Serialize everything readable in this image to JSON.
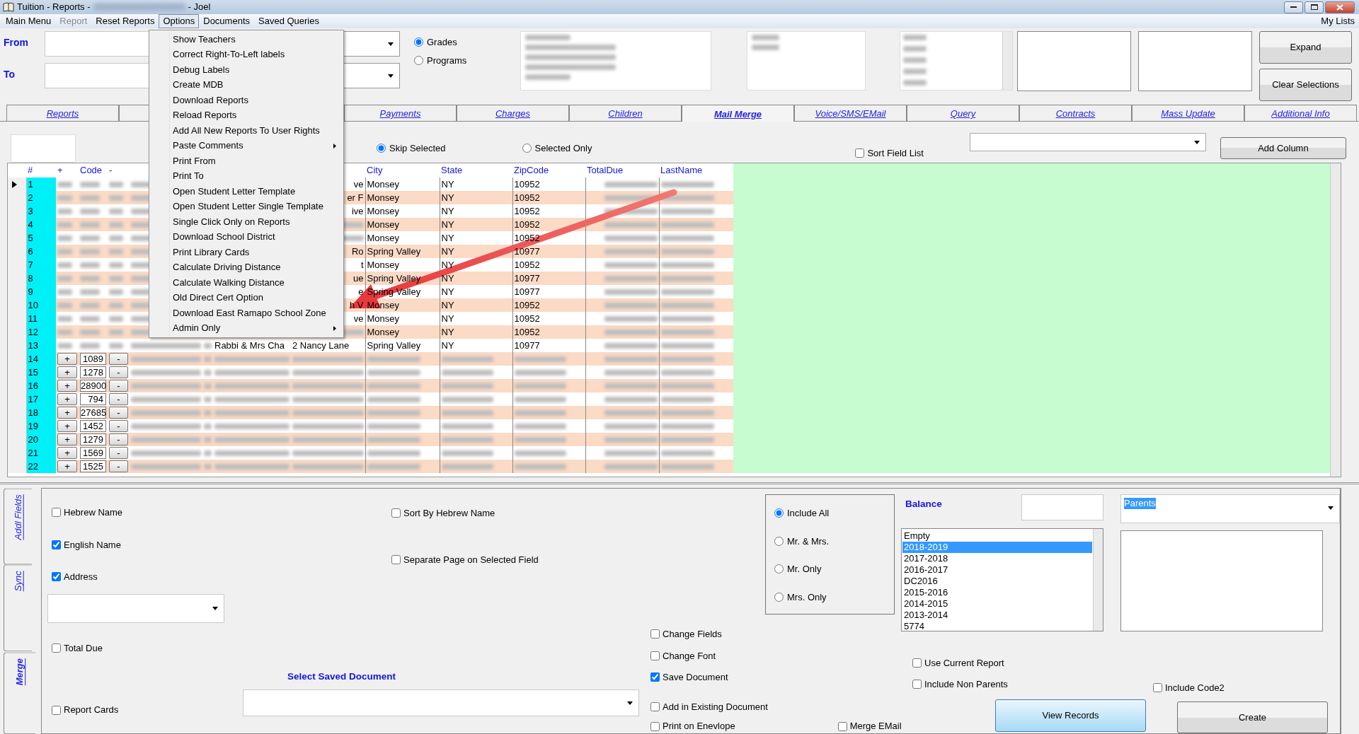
{
  "window": {
    "title": "Tuition - Reports -",
    "title_suffix": "- Joel"
  },
  "menu_bar": {
    "items": [
      {
        "label": "Main Menu",
        "disabled": false,
        "selected": false
      },
      {
        "label": "Report",
        "disabled": true,
        "selected": false
      },
      {
        "label": "Reset Reports",
        "disabled": false,
        "selected": false
      },
      {
        "label": "Options",
        "disabled": false,
        "selected": true
      },
      {
        "label": "Documents",
        "disabled": false,
        "selected": false
      },
      {
        "label": "Saved Queries",
        "disabled": false,
        "selected": false
      }
    ],
    "right_label": "My Lists"
  },
  "options_menu": [
    {
      "label": "Show Teachers",
      "submenu": false
    },
    {
      "label": "Correct Right-To-Left labels",
      "submenu": false
    },
    {
      "label": "Debug Labels",
      "submenu": false
    },
    {
      "label": "Create MDB",
      "submenu": false
    },
    {
      "label": "Download Reports",
      "submenu": false
    },
    {
      "label": "Reload Reports",
      "submenu": false
    },
    {
      "label": "Add All New Reports To User Rights",
      "submenu": false
    },
    {
      "label": "Paste Comments",
      "submenu": true
    },
    {
      "label": "Print From",
      "submenu": false
    },
    {
      "label": "Print To",
      "submenu": false
    },
    {
      "label": "Open Student Letter Template",
      "submenu": false
    },
    {
      "label": "Open Student Letter Single Template",
      "submenu": false
    },
    {
      "label": "Single Click Only on Reports",
      "submenu": false
    },
    {
      "label": "Download School District",
      "submenu": false
    },
    {
      "label": "Print Library Cards",
      "submenu": false
    },
    {
      "label": "Calculate Driving Distance",
      "submenu": false
    },
    {
      "label": "Calculate Walking Distance",
      "submenu": false
    },
    {
      "label": "Old Direct Cert Option",
      "submenu": false
    },
    {
      "label": "Download East Ramapo School Zone",
      "submenu": false
    },
    {
      "label": "Admin Only",
      "submenu": true
    }
  ],
  "filters": {
    "from_label": "From",
    "to_label": "To",
    "radios": [
      {
        "label": "Grades",
        "selected": true
      },
      {
        "label": "Programs",
        "selected": false
      }
    ],
    "buttons": [
      "Expand",
      "Clear Selections"
    ]
  },
  "tabs": [
    {
      "label": "Reports",
      "selected": false
    },
    {
      "label": "Payments",
      "selected": false
    },
    {
      "label": "Charges",
      "selected": false
    },
    {
      "label": "Children",
      "selected": false
    },
    {
      "label": "Mail Merge",
      "selected": true
    },
    {
      "label": "Voice/SMS/EMail",
      "selected": false
    },
    {
      "label": "Query",
      "selected": false
    },
    {
      "label": "Contracts",
      "selected": false
    },
    {
      "label": "Mass Update",
      "selected": false
    },
    {
      "label": "Additional Info",
      "selected": false
    }
  ],
  "toolbar": {
    "radios": [
      {
        "label": "Skip Selected",
        "selected": true
      },
      {
        "label": "Selected Only",
        "selected": false
      }
    ],
    "sort_field_list": {
      "label": "Sort Field List",
      "checked": false
    },
    "add_column": "Add Column"
  },
  "grid": {
    "columns": [
      "#",
      "+",
      "Code",
      "-",
      "City",
      "State",
      "ZipCode",
      "TotalDue",
      "LastName"
    ],
    "rows": [
      {
        "num": "1",
        "current": true,
        "address": "ve",
        "city": "Monsey",
        "state": "NY",
        "zip": "10952"
      },
      {
        "num": "2",
        "current": false,
        "address": "er F",
        "city": "Monsey",
        "state": "NY",
        "zip": "10952"
      },
      {
        "num": "3",
        "current": false,
        "address": "ive",
        "city": "Monsey",
        "state": "NY",
        "zip": "10952"
      },
      {
        "num": "4",
        "current": false,
        "city": "Monsey",
        "state": "NY",
        "zip": "10952"
      },
      {
        "num": "5",
        "current": false,
        "city": "Monsey",
        "state": "NY",
        "zip": "10952"
      },
      {
        "num": "6",
        "current": false,
        "address": "Ro",
        "city": "Spring Valley",
        "state": "NY",
        "zip": "10977"
      },
      {
        "num": "7",
        "current": false,
        "address": "t",
        "city": "Monsey",
        "state": "NY",
        "zip": "10952"
      },
      {
        "num": "8",
        "current": false,
        "address": "ue",
        "city": "Spring Valley",
        "state": "NY",
        "zip": "10977"
      },
      {
        "num": "9",
        "current": false,
        "address": "e",
        "city": "Spring Valley",
        "state": "NY",
        "zip": "10977"
      },
      {
        "num": "10",
        "current": false,
        "address": "h V",
        "city": "Monsey",
        "state": "NY",
        "zip": "10952"
      },
      {
        "num": "11",
        "current": false,
        "address": "ve",
        "city": "Monsey",
        "state": "NY",
        "zip": "10952"
      },
      {
        "num": "12",
        "current": false,
        "city": "Monsey",
        "state": "NY",
        "zip": "10952"
      },
      {
        "num": "13",
        "current": false,
        "name": "Rabbi & Mrs Cha",
        "address": "2 Nancy Lane",
        "city": "Spring Valley",
        "state": "NY",
        "zip": "10977"
      },
      {
        "num": "14",
        "current": false,
        "plus": "+",
        "code": "1089",
        "minus": "-"
      },
      {
        "num": "15",
        "current": false,
        "plus": "+",
        "code": "1278",
        "minus": "-"
      },
      {
        "num": "16",
        "current": false,
        "plus": "+",
        "code": "28900",
        "minus": "-"
      },
      {
        "num": "17",
        "current": false,
        "plus": "+",
        "code": "794",
        "minus": "-"
      },
      {
        "num": "18",
        "current": false,
        "plus": "+",
        "code": "27685",
        "minus": "-"
      },
      {
        "num": "19",
        "current": false,
        "plus": "+",
        "code": "1452",
        "minus": "-"
      },
      {
        "num": "20",
        "current": false,
        "plus": "+",
        "code": "1279",
        "minus": "-"
      },
      {
        "num": "21",
        "current": false,
        "plus": "+",
        "code": "1569",
        "minus": "-"
      },
      {
        "num": "22",
        "current": false,
        "plus": "+",
        "code": "1525",
        "minus": "-"
      }
    ]
  },
  "side_tabs": [
    {
      "label": "Addl Fields",
      "selected": false
    },
    {
      "label": "Sync",
      "selected": false
    },
    {
      "label": "Merge",
      "selected": true
    }
  ],
  "merge": {
    "name_checks": [
      {
        "label": "Hebrew Name",
        "checked": false
      },
      {
        "label": "English Name",
        "checked": true
      },
      {
        "label": "Address",
        "checked": true
      }
    ],
    "total_due": {
      "label": "Total Due",
      "checked": false
    },
    "report_cards": {
      "label": "Report Cards",
      "checked": false
    },
    "sort_hebrew": {
      "label": "Sort By Hebrew Name",
      "checked": false
    },
    "separate_page": {
      "label": "Separate Page on Selected Field",
      "checked": false
    },
    "saved_doc_label": "Select Saved Document",
    "doc_checks": [
      {
        "label": "Change Fields",
        "checked": false
      },
      {
        "label": "Change Font",
        "checked": false
      },
      {
        "label": "Save Document",
        "checked": true
      },
      {
        "label": "Add in Existing Document",
        "checked": false
      }
    ],
    "print_envelope": {
      "label": "Print on Enevlope",
      "checked": false
    },
    "merge_email": {
      "label": "Merge EMail",
      "checked": false
    },
    "salutation": [
      {
        "label": "Include All",
        "selected": true
      },
      {
        "label": "Mr. & Mrs.",
        "selected": false
      },
      {
        "label": "Mr. Only",
        "selected": false
      },
      {
        "label": "Mrs. Only",
        "selected": false
      }
    ],
    "balance_label": "Balance",
    "balance_years": [
      {
        "label": "Empty",
        "selected": false
      },
      {
        "label": "2018-2019",
        "selected": true
      },
      {
        "label": "2017-2018",
        "selected": false
      },
      {
        "label": "2016-2017",
        "selected": false
      },
      {
        "label": "DC2016",
        "selected": false
      },
      {
        "label": "2015-2016",
        "selected": false
      },
      {
        "label": "2014-2015",
        "selected": false
      },
      {
        "label": "2013-2014",
        "selected": false
      },
      {
        "label": "5774",
        "selected": false
      }
    ],
    "recipient": "Parents",
    "use_current_report": {
      "label": "Use Current Report",
      "checked": false
    },
    "include_non_parents": {
      "label": "Include Non Parents",
      "checked": false
    },
    "include_code2": {
      "label": "Include Code2",
      "checked": false
    },
    "buttons": [
      "View Records",
      "Create"
    ]
  }
}
